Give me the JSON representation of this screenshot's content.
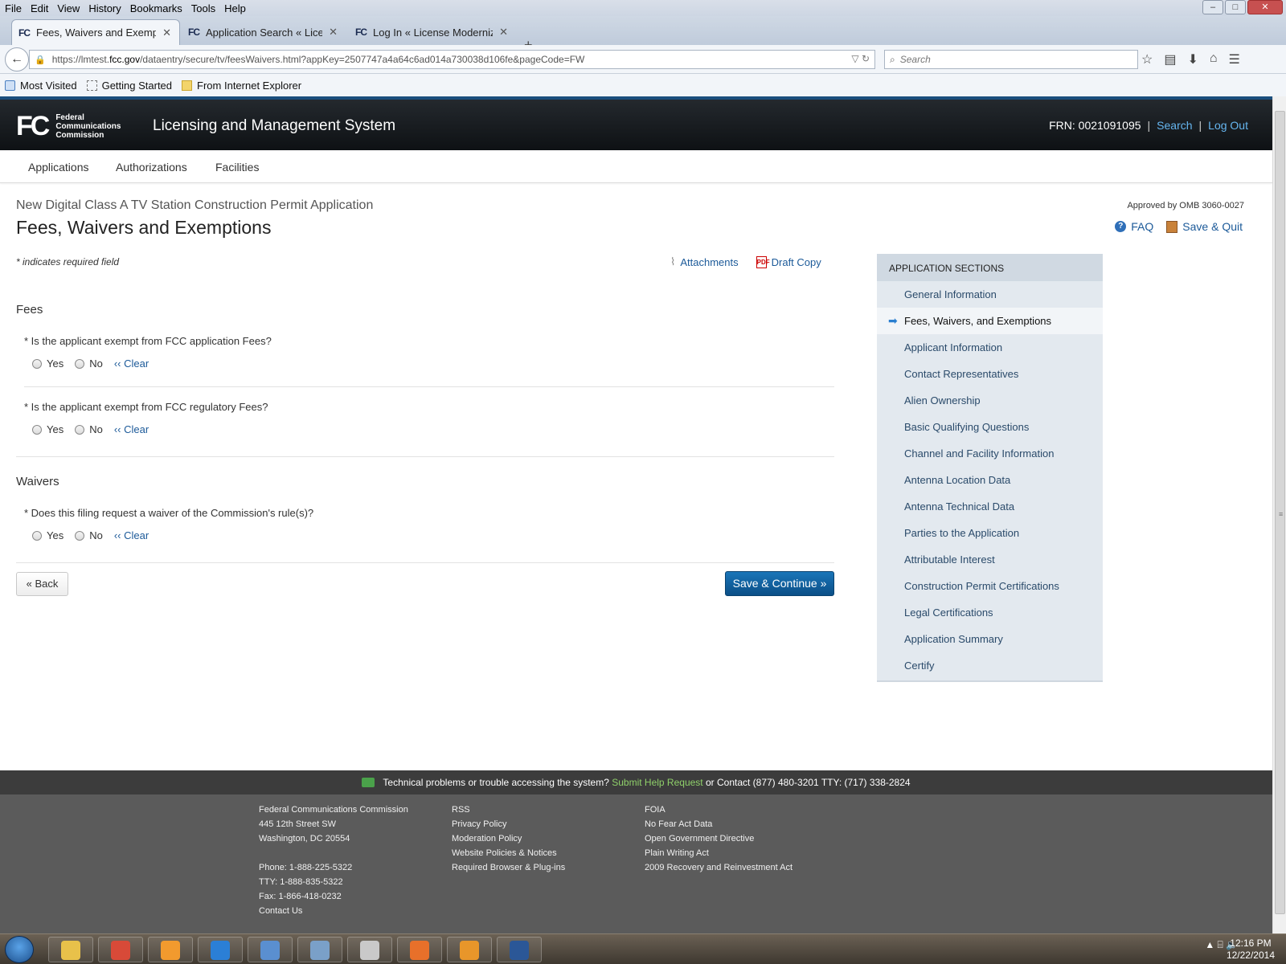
{
  "browser": {
    "menu": [
      "File",
      "Edit",
      "View",
      "History",
      "Bookmarks",
      "Tools",
      "Help"
    ],
    "window_buttons": [
      "–",
      "□",
      "✕"
    ],
    "tabs": [
      {
        "favicon": "FC",
        "title": "Fees, Waivers and Exempti...",
        "close": "✕"
      },
      {
        "favicon": "FC",
        "title": "Application Search « Licen...",
        "close": "✕"
      },
      {
        "favicon": "FC",
        "title": "Log In « License Moderniza...",
        "close": "✕"
      }
    ],
    "new_tab": "+",
    "back": "←",
    "url_prefix": "https://lmtest.",
    "url_domain": "fcc.gov",
    "url_path": "/dataentry/secure/tv/feesWaivers.html?appKey=2507747a4a64c6ad014a730038d106fe&pageCode=FW",
    "url_end": "▽  ↻",
    "search_placeholder": "Search",
    "search_icon": "⌕",
    "toolbar_icons": [
      "☆",
      "▤",
      "⬇",
      "⌂",
      "☰"
    ],
    "bookmarks": [
      "Most Visited",
      "Getting Started",
      "From Internet Explorer"
    ]
  },
  "header": {
    "logo_mark": "FC",
    "agency_line1": "Federal",
    "agency_line2": "Communications",
    "agency_line3": "Commission",
    "system_name": "Licensing and Management System",
    "frn": "FRN: 0021091095",
    "sep": "|",
    "search": "Search",
    "logout": "Log Out"
  },
  "nav": [
    "Applications",
    "Authorizations",
    "Facilities"
  ],
  "page": {
    "subtitle": "New Digital Class A TV Station Construction Permit Application",
    "title": "Fees, Waivers and Exemptions",
    "omb": "Approved by OMB 3060-0027",
    "faq": "FAQ",
    "save_quit": "Save & Quit",
    "required_note": "* indicates required field",
    "attachments": "Attachments",
    "draft_copy": "Draft Copy",
    "pdf_label": "PDF",
    "fees_heading": "Fees",
    "q1": "* Is the applicant exempt from FCC application Fees?",
    "q2": "* Is the applicant exempt from FCC regulatory Fees?",
    "waivers_heading": "Waivers",
    "q3": "* Does this filing request a waiver of the Commission's rule(s)?",
    "yes": "Yes",
    "no": "No",
    "clear": "‹‹ Clear",
    "back": "« Back",
    "save_continue": "Save & Continue »"
  },
  "sections": {
    "heading": "APPLICATION SECTIONS",
    "items": [
      "General Information",
      "Fees, Waivers, and Exemptions",
      "Applicant Information",
      "Contact Representatives",
      "Alien Ownership",
      "Basic Qualifying Questions",
      "Channel and Facility Information",
      "Antenna Location Data",
      "Antenna Technical Data",
      "Parties to the Application",
      "Attributable Interest",
      "Construction Permit Certifications",
      "Legal Certifications",
      "Application Summary",
      "Certify"
    ],
    "active_index": 1
  },
  "footer": {
    "help_text": "Technical problems or trouble accessing the system?",
    "help_link": "Submit Help Request",
    "help_contact": "or Contact (877) 480-3201 TTY: (717) 338-2824",
    "col1": [
      "Federal Communications Commission",
      "445 12th Street SW",
      "Washington, DC 20554",
      "",
      "Phone: 1-888-225-5322",
      "TTY: 1-888-835-5322",
      "Fax: 1-866-418-0232",
      "Contact Us"
    ],
    "col2": [
      "RSS",
      "Privacy Policy",
      "Moderation Policy",
      "Website Policies & Notices",
      "Required Browser & Plug-ins"
    ],
    "col3": [
      "FOIA",
      "No Fear Act Data",
      "Open Government Directive",
      "Plain Writing Act",
      "2009 Recovery and Reinvestment Act"
    ]
  },
  "taskbar": {
    "apps": [
      "file-explorer",
      "chrome",
      "media-player",
      "internet-explorer",
      "network",
      "remote-desktop",
      "phone",
      "firefox",
      "outlook",
      "word"
    ],
    "app_colors": [
      "#e8c14a",
      "#d84a38",
      "#f29a2e",
      "#2b7fd6",
      "#5a8fd0",
      "#7aa0c8",
      "#c9c9c9",
      "#e8702a",
      "#e8962a",
      "#2b5797"
    ],
    "tray": "▲  ⌸  🔈",
    "time": "12:16 PM",
    "date": "12/22/2014"
  }
}
